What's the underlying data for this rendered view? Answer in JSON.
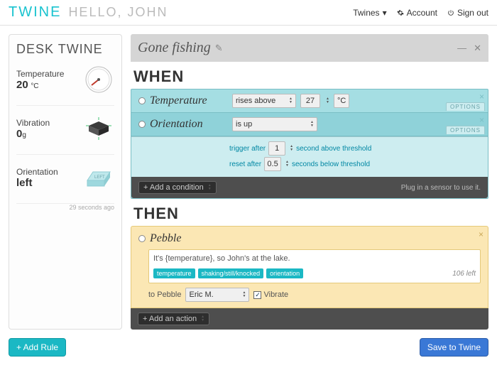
{
  "header": {
    "brand": "TWINE",
    "hello": "HELLO, JOHN",
    "nav": {
      "twines": "Twines",
      "account": "Account",
      "signout": "Sign out"
    }
  },
  "sidebar": {
    "title": "DESK TWINE",
    "temperature": {
      "label": "Temperature",
      "value": "20",
      "unit": "°C"
    },
    "vibration": {
      "label": "Vibration",
      "value": "0",
      "unit": "g"
    },
    "orientation": {
      "label": "Orientation",
      "value": "left"
    },
    "footer": "29 seconds ago"
  },
  "rule": {
    "title": "Gone fishing",
    "when_label": "WHEN",
    "then_label": "THEN",
    "conditions": {
      "temperature": {
        "label": "Temperature",
        "operator": "rises above",
        "value": "27",
        "unit": "°C",
        "options_label": "OPTIONS"
      },
      "orientation": {
        "label": "Orientation",
        "operator": "is up",
        "options_label": "OPTIONS",
        "trigger_label_a": "trigger after",
        "trigger_value": "1",
        "trigger_label_b": "second above threshold",
        "reset_label_a": "reset after",
        "reset_value": "0.5",
        "reset_label_b": "seconds below threshold"
      }
    },
    "add_condition": "+ Add a condition",
    "cond_hint": "Plug in a sensor to use it.",
    "action": {
      "label": "Pebble",
      "message": "It's {temperature}, so John's at the lake.",
      "chips": {
        "a": "temperature",
        "b": "shaking/still/knocked",
        "c": "orientation"
      },
      "counter": "106 left",
      "to_label": "to Pebble",
      "recipient": "Eric M.",
      "vibrate_label": "Vibrate"
    },
    "add_action": "+ Add an action"
  },
  "footer": {
    "add_rule": "+  Add Rule",
    "save": "Save to Twine"
  }
}
